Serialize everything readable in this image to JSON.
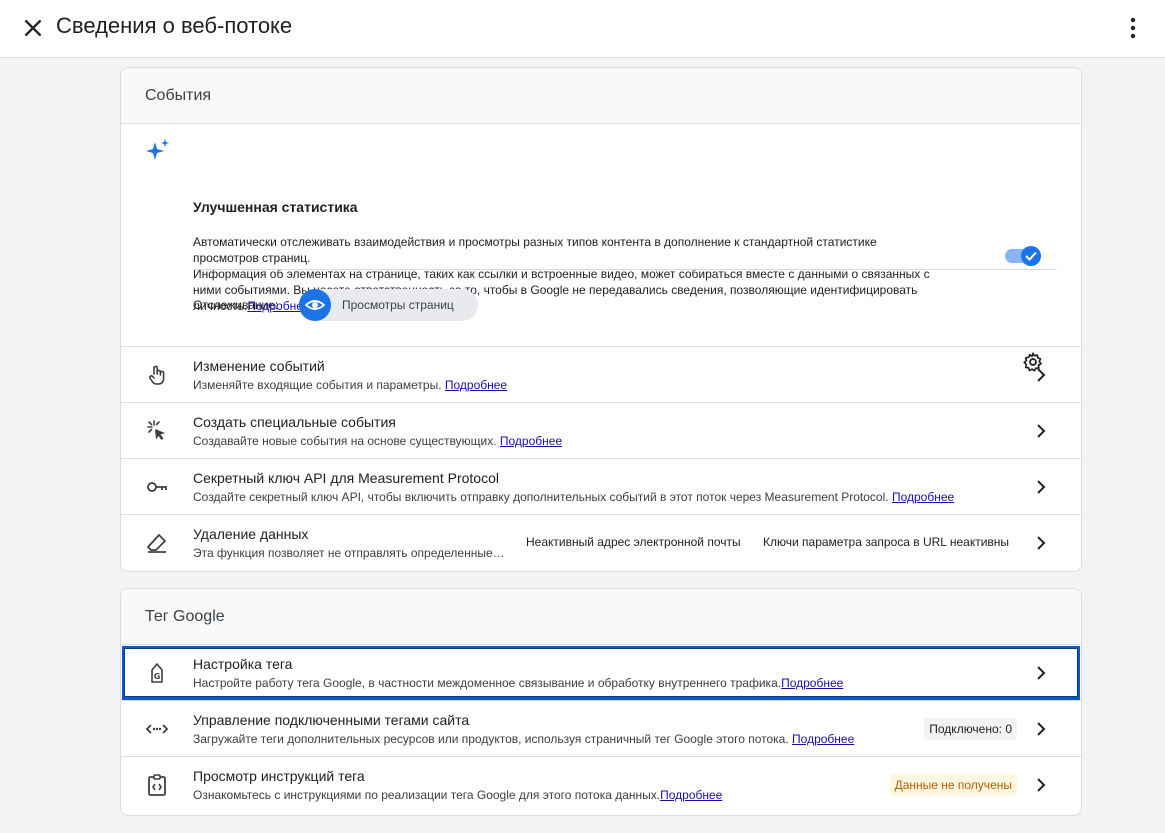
{
  "header": {
    "title": "Сведения о веб-потоке"
  },
  "events_card": {
    "title": "События",
    "enhanced": {
      "title": "Улучшенная статистика",
      "desc1": "Автоматически отслеживать взаимодействия и просмотры разных типов контента в дополнение к стандартной статистике",
      "desc2": "просмотров страниц.",
      "desc3": "Информация об элементах на странице, таких как ссылки и встроенные видео, может собираться вместе с данными о связанных с",
      "desc4": "ними событиями. Вы несете ответственность за то, чтобы в Google не передавались сведения, позволяющие идентифицировать",
      "desc5": "личность.",
      "link": "Подробнее",
      "toggle_on": true,
      "tracking_label": "Отслеживание:",
      "tracking_chip": "Просмотры страниц"
    },
    "rows": [
      {
        "title": "Изменение событий",
        "desc": "Изменяйте входящие события и параметры.",
        "link": "Подробнее"
      },
      {
        "title": "Создать специальные события",
        "desc": "Создавайте новые события на основе существующих.",
        "link": "Подробнее"
      },
      {
        "title": "Секретный ключ API для Measurement Protocol",
        "desc": "Создайте секретный ключ API, чтобы включить отправку дополнительных событий в этот поток через Measurement Protocol.",
        "link": "Подробнее"
      },
      {
        "title": "Удаление данных",
        "desc": "Эта функция позволяет не отправлять определенные…",
        "chip1": "Неактивный адрес электронной почты",
        "chip2": "Ключи параметра запроса в URL неактивны"
      }
    ]
  },
  "tag_card": {
    "title": "Тег Google",
    "rows": [
      {
        "title": "Настройка тега",
        "desc": "Настройте работу тега Google, в частности междоменное связывание и обработку внутреннего трафика.",
        "link": "Подробнее"
      },
      {
        "title": "Управление подключенными тегами сайта",
        "desc": "Загружайте теги дополнительных ресурсов или продуктов, используя страничный тег Google этого потока.",
        "link": "Подробнее",
        "badge": "Подключено: 0"
      },
      {
        "title": "Просмотр инструкций тега",
        "desc": "Ознакомьтесь с инструкциями по реализации тега Google для этого потока данных.",
        "link": "Подробнее",
        "badge": "Данные не получены"
      }
    ]
  },
  "colors": {
    "accent": "#1a73e8",
    "warning_bg": "#fef7e0",
    "warning_text": "#b06000"
  }
}
